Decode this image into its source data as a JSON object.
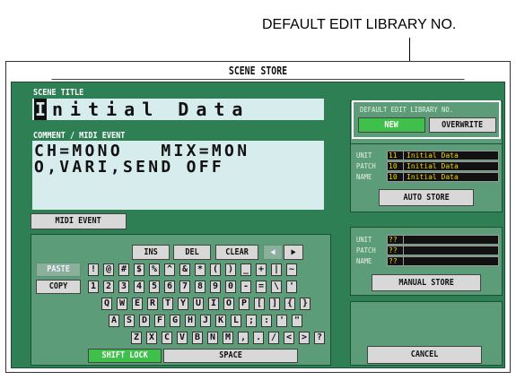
{
  "callout": {
    "label": "DEFAULT EDIT LIBRARY NO."
  },
  "window": {
    "title": "SCENE STORE"
  },
  "scene_title": {
    "label": "SCENE TITLE",
    "cursor_char": "I",
    "rest": "nitial Data"
  },
  "comment": {
    "label": "COMMENT / MIDI EVENT",
    "text": "CH=MONO   MIX=MON\nO,VARI,SEND OFF"
  },
  "midi_event_button": "MIDI EVENT",
  "keyboard": {
    "ins": "INS",
    "del": "DEL",
    "clear": "CLEAR",
    "left_arrow": "◀",
    "right_arrow": "▶",
    "paste": "PASTE",
    "copy": "COPY",
    "row1": [
      "!",
      "@",
      "#",
      "$",
      "%",
      "^",
      "&",
      "*",
      "(",
      ")",
      "_",
      "+",
      "|",
      "~"
    ],
    "row2": [
      "1",
      "2",
      "3",
      "4",
      "5",
      "6",
      "7",
      "8",
      "9",
      "0",
      "-",
      "=",
      "\\",
      "'"
    ],
    "row3": [
      "Q",
      "W",
      "E",
      "R",
      "T",
      "Y",
      "U",
      "I",
      "O",
      "P",
      "[",
      "]",
      "{",
      "}"
    ],
    "row4": [
      "A",
      "S",
      "D",
      "F",
      "G",
      "H",
      "J",
      "K",
      "L",
      ";",
      ":",
      "'",
      "\""
    ],
    "row5": [
      "Z",
      "X",
      "C",
      "V",
      "B",
      "N",
      "M",
      ",",
      ".",
      "/",
      "<",
      ">",
      "?"
    ],
    "shift_lock": "SHIFT LOCK",
    "space": "SPACE"
  },
  "library": {
    "label": "DEFAULT EDIT LIBRARY NO.",
    "new": "NEW",
    "overwrite": "OVERWRITE"
  },
  "auto_store": {
    "unit_label": "UNIT",
    "patch_label": "PATCH",
    "name_label": "NAME",
    "unit_num": "11",
    "unit_name": "Initial Data",
    "patch_num": "10",
    "patch_name": "Initial Data",
    "name_num": "10",
    "name_name": "Initial Data",
    "button": "AUTO STORE"
  },
  "manual_store": {
    "unit_label": "UNIT",
    "patch_label": "PATCH",
    "name_label": "NAME",
    "unit_num": "??",
    "patch_num": "??",
    "name_num": "??",
    "button": "MANUAL STORE"
  },
  "cancel_button": "CANCEL",
  "colors": {
    "panel_green": "#2f7f55",
    "highlight_green": "#3fc04a",
    "field_bg": "#d7ecec",
    "data_yellow": "#f2d400"
  }
}
